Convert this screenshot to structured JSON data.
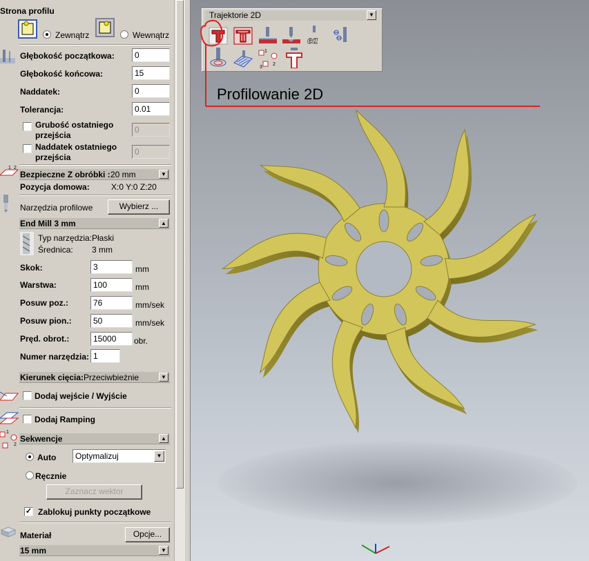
{
  "panel": {
    "section_title": "Strona profilu",
    "side_outside": "Zewnątrz",
    "side_inside": "Wewnątrz",
    "fields": [
      {
        "label": "Głębokość początkowa:",
        "value": "0"
      },
      {
        "label": "Głębokość końcowa:",
        "value": "15"
      },
      {
        "label": "Naddatek:",
        "value": "0"
      },
      {
        "label": "Tolerancja:",
        "value": "0.01"
      }
    ],
    "last_pass_thickness": {
      "label_line1": "Grubość ostatniego",
      "label_line2": "przejścia",
      "value": "0",
      "checked": false
    },
    "last_pass_allowance": {
      "label_line1": "Naddatek ostatniego",
      "label_line2": "przejścia",
      "value": "0",
      "checked": false
    },
    "safe_z": {
      "label": "Bezpieczne Z obróbki :",
      "value": "20 mm"
    },
    "home": {
      "label": "Pozycja domowa:",
      "value": "X:0 Y:0 Z:20"
    },
    "tools": {
      "label": "Narzędzia profilowe",
      "select_button": "Wybierz ..."
    },
    "tool": {
      "name": "End Mill 3 mm",
      "type_label": "Typ narzędzia:",
      "type_value": "Płaski",
      "diameter_label": "Średnica:",
      "diameter_value": "3 mm"
    },
    "tool_params": [
      {
        "label": "Skok:",
        "value": "3",
        "unit": "mm"
      },
      {
        "label": "Warstwa:",
        "value": "100",
        "unit": "mm"
      },
      {
        "label": "Posuw poz.:",
        "value": "76",
        "unit": "mm/sek"
      },
      {
        "label": "Posuw pion.:",
        "value": "50",
        "unit": "mm/sek"
      },
      {
        "label": "Pręd. obrot.:",
        "value": "15000",
        "unit": "obr."
      }
    ],
    "tool_number": {
      "label": "Numer narzędzia:",
      "value": "1"
    },
    "cut_direction": {
      "label": "Kierunek cięcia:",
      "value": "Przeciwbieżnie"
    },
    "lead_in": {
      "label": "Dodaj wejście / Wyjście",
      "checked": false
    },
    "ramping": {
      "label": "Dodaj Ramping",
      "checked": false
    },
    "sequence": {
      "title": "Sekwencje",
      "auto_label": "Auto",
      "auto_selected": true,
      "auto_option": "Optymalizuj",
      "manual_label": "Ręcznie",
      "mark_vector_button": "Zaznacz wektor"
    },
    "lock_start": {
      "label": "Zablokuj punkty początkowe",
      "checked": true
    },
    "material": {
      "label": "Materiał",
      "options_button": "Opcje...",
      "value": "15 mm"
    }
  },
  "toolbar": {
    "title": "Trajektorie 2D",
    "icons": [
      "profile-2d-icon",
      "pocket-2d-icon",
      "drill-icon",
      "vcarve-icon",
      "engrave-text-icon",
      "inlay-icon",
      "fluting-icon",
      "texture-icon",
      "sequence-icon",
      "profile-edit-icon"
    ]
  },
  "annotation": {
    "text": "Profilowanie 2D",
    "color": "#e02020"
  },
  "colors": {
    "model": "#d2c65a",
    "panel": "#d4d0c8"
  }
}
